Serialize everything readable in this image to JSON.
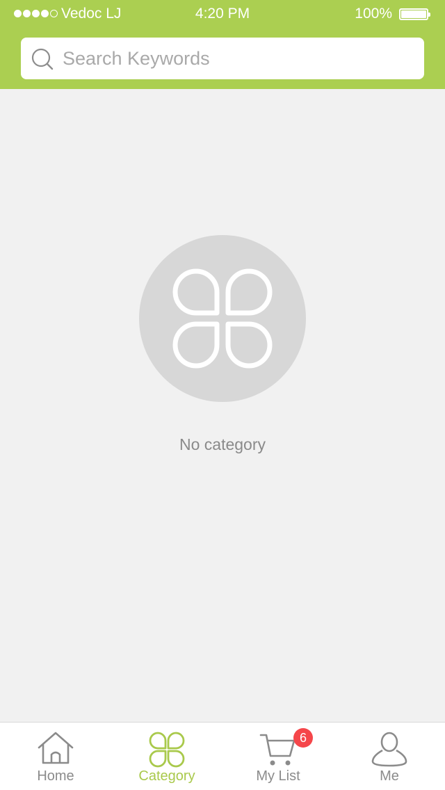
{
  "status_bar": {
    "carrier": "Vedoc LJ",
    "time": "4:20 PM",
    "battery": "100%"
  },
  "search": {
    "placeholder": "Search Keywords"
  },
  "empty_state": {
    "message": "No category"
  },
  "tab_bar": {
    "tabs": [
      {
        "label": "Home",
        "icon": "home-icon",
        "active": false
      },
      {
        "label": "Category",
        "icon": "clover-icon",
        "active": true
      },
      {
        "label": "My List",
        "icon": "cart-icon",
        "active": false,
        "badge": "6"
      },
      {
        "label": "Me",
        "icon": "user-icon",
        "active": false
      }
    ]
  },
  "colors": {
    "brand_green": "#abcf51",
    "active_tab": "#a9c94b",
    "badge_red": "#f5464a",
    "background": "#f1f1f1"
  }
}
